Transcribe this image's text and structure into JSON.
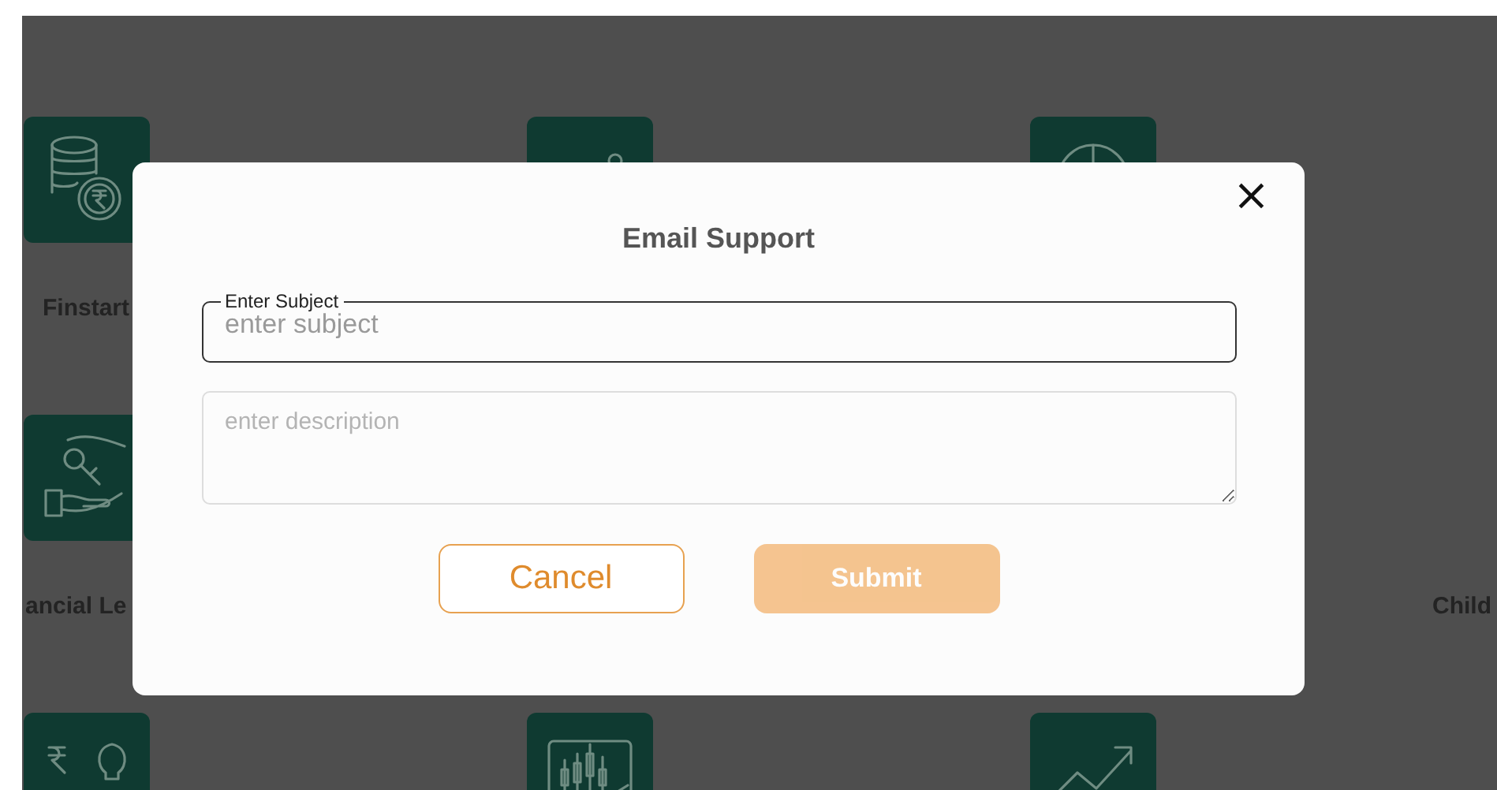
{
  "background": {
    "rows": [
      {
        "tiles": [
          {
            "kind": "tile",
            "label": "Finstart"
          },
          {
            "kind": "tile"
          },
          {
            "kind": "tile"
          }
        ]
      },
      {
        "tiles": [
          {
            "kind": "tile",
            "label": "ancial Le"
          },
          {
            "kind": "text",
            "label": "Child"
          }
        ]
      },
      {
        "tiles": [
          {
            "kind": "tile"
          },
          {
            "kind": "tile"
          },
          {
            "kind": "tile"
          }
        ]
      }
    ]
  },
  "dialog": {
    "title": "Email Support",
    "close": "×",
    "subject": {
      "label": "Enter Subject",
      "placeholder": "enter subject"
    },
    "description": {
      "placeholder": "enter description"
    },
    "buttons": [
      {
        "kind": "outline",
        "label": "Cancel",
        "disabled": false
      },
      {
        "kind": "filled",
        "label": "Submit",
        "disabled": true
      }
    ]
  }
}
